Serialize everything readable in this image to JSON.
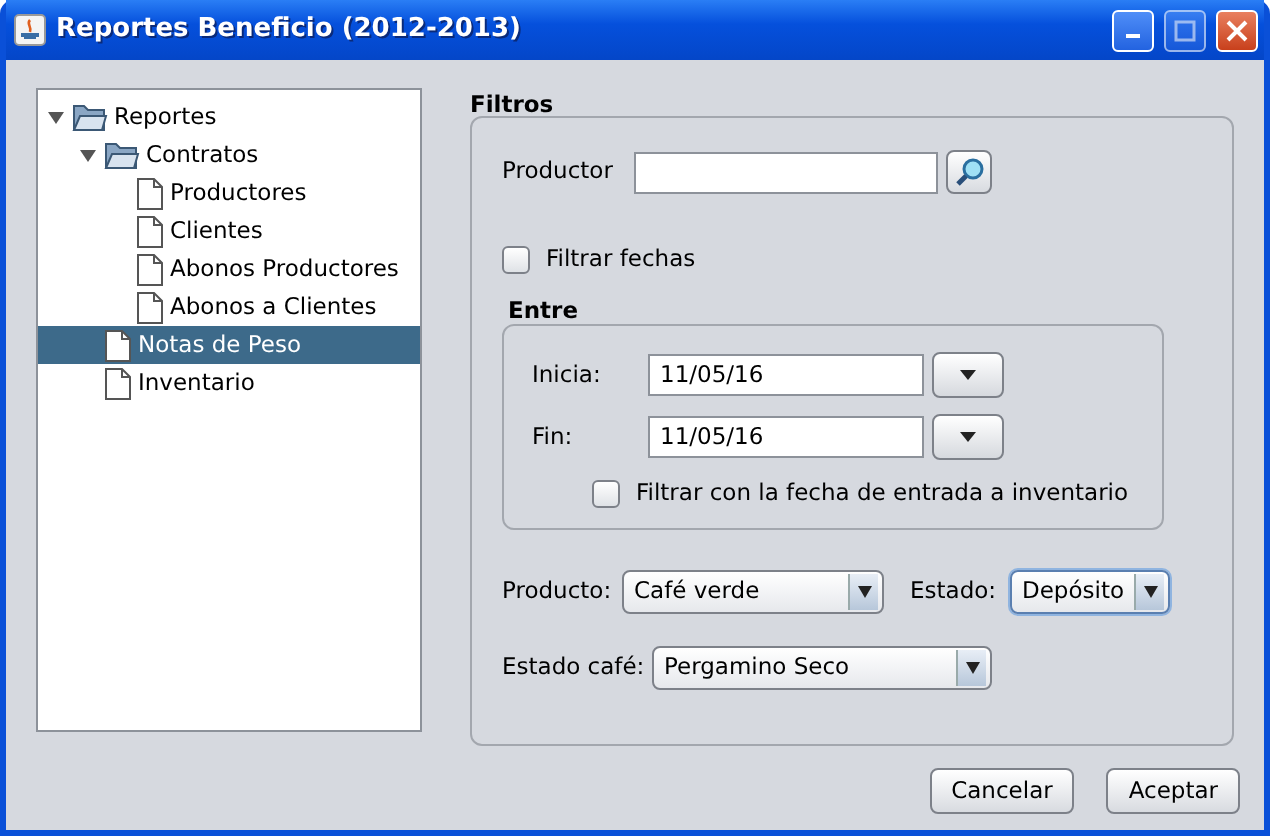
{
  "window": {
    "title": "Reportes Beneficio (2012-2013)"
  },
  "tree": [
    {
      "label": "Reportes",
      "kind": "folder",
      "expanded": true,
      "selected": false,
      "children": [
        {
          "label": "Contratos",
          "kind": "folder",
          "expanded": true,
          "selected": false,
          "children": [
            {
              "label": "Productores",
              "kind": "file",
              "selected": false
            },
            {
              "label": "Clientes",
              "kind": "file",
              "selected": false
            },
            {
              "label": "Abonos Productores",
              "kind": "file",
              "selected": false
            },
            {
              "label": "Abonos a Clientes",
              "kind": "file",
              "selected": false
            }
          ]
        },
        {
          "label": "Notas de Peso",
          "kind": "file",
          "selected": true
        },
        {
          "label": "Inventario",
          "kind": "file",
          "selected": false
        }
      ]
    }
  ],
  "filters": {
    "title": "Filtros",
    "productor": {
      "label": "Productor"
    },
    "date_filter": {
      "label": "Filtrar fechas",
      "checked": false
    },
    "range": {
      "title": "Entre",
      "start": {
        "label": "Inicia:",
        "value": "11/05/16"
      },
      "end": {
        "label": "Fin:",
        "value": "11/05/16"
      },
      "inventory_filter": {
        "label": "Filtrar con la fecha de entrada a inventario",
        "checked": false
      }
    },
    "producto": {
      "label": "Producto:",
      "value": "Café verde",
      "focused": false
    },
    "estado": {
      "label": "Estado:",
      "value": "Depósito",
      "focused": true
    },
    "estado_cafe": {
      "label": "Estado café:",
      "value": "Pergamino Seco",
      "focused": false
    }
  },
  "buttons": [
    "Cancelar",
    "Aceptar"
  ]
}
